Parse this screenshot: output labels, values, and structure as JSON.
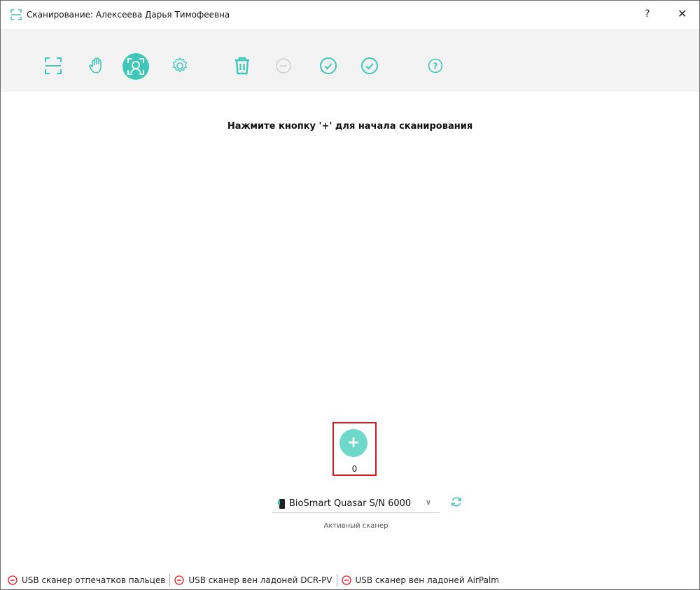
{
  "window": {
    "title": "Сканирование: Алексеева  Дарья  Тимофеевна",
    "help_label": "?",
    "close_label": "✕"
  },
  "toolbar": {
    "accent_color": "#3ec7b6",
    "buttons": [
      {
        "name": "fingerprint-scan-icon",
        "active": false
      },
      {
        "name": "palm-icon",
        "active": false
      },
      {
        "name": "face-scan-icon",
        "active": true
      },
      {
        "name": "settings-gear-icon",
        "active": false
      },
      {
        "name": "trash-icon",
        "active": false
      },
      {
        "name": "minus-circle-icon",
        "active": false,
        "disabled": true
      },
      {
        "name": "check-circle-icon",
        "active": false
      },
      {
        "name": "check-circle-icon",
        "active": false
      },
      {
        "name": "help-circle-icon",
        "active": false
      }
    ]
  },
  "main": {
    "hint": "Нажмите кнопку '+' для начала сканирования",
    "add_label": "+",
    "count": "0",
    "scanner": {
      "selected": "BioSmart Quasar S/N 6000",
      "caption": "Активный сканер"
    }
  },
  "status": {
    "items": [
      {
        "label": "USB сканер отпечатков пальцев",
        "color": "#e0141e"
      },
      {
        "label": "USB сканер вен ладоней DCR-PV",
        "color": "#e0141e"
      },
      {
        "label": "USB сканер вен ладоней AirPalm",
        "color": "#e0141e"
      }
    ]
  }
}
